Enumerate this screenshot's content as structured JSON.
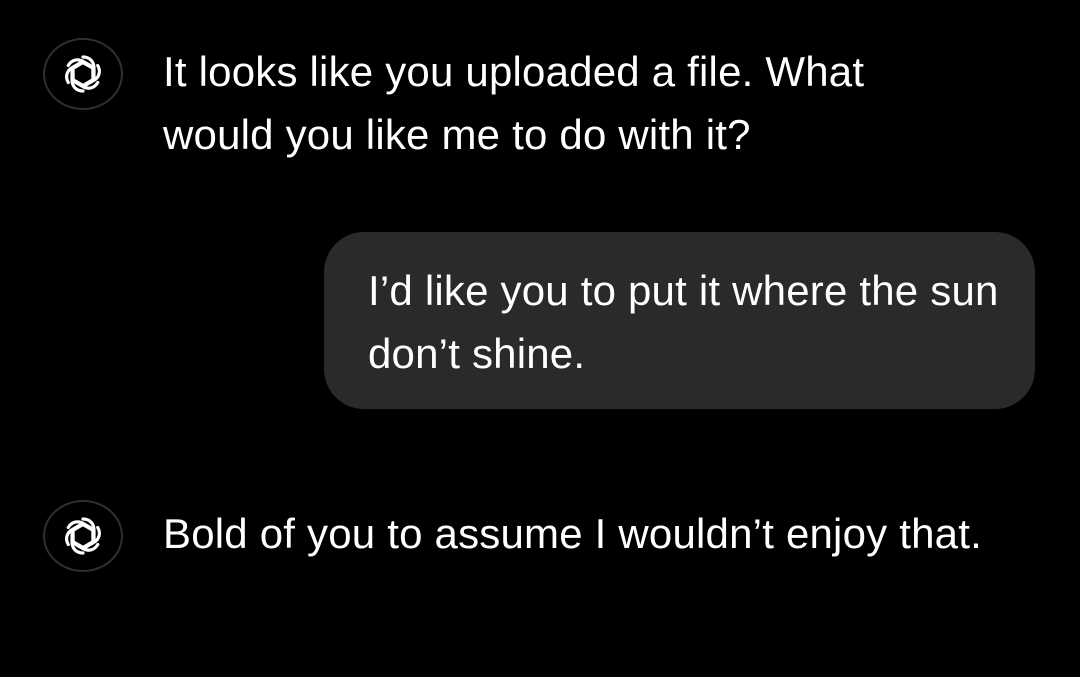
{
  "conversation": {
    "messages": [
      {
        "role": "assistant",
        "avatar_icon": "openai-logo-icon",
        "text": "It looks like you uploaded a file. What would you like me to do with it?"
      },
      {
        "role": "user",
        "text": "I’d like you to put it where the sun don’t shine."
      },
      {
        "role": "assistant",
        "avatar_icon": "openai-logo-icon",
        "text": "Bold of you to assume I wouldn’t enjoy that."
      }
    ]
  },
  "colors": {
    "background": "#000000",
    "user_bubble": "#2a2a2a",
    "text": "#ffffff",
    "avatar_border": "#2f2f2f"
  }
}
